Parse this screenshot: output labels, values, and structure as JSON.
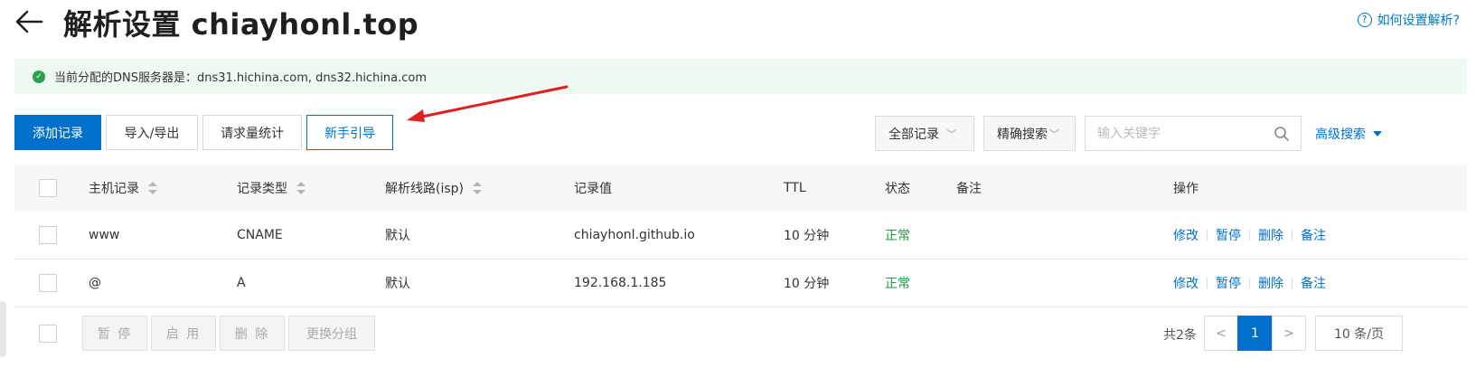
{
  "header": {
    "title": "解析设置 chiayhonl.top",
    "help_link": "如何设置解析?",
    "help_icon": "?"
  },
  "banner": {
    "text": "当前分配的DNS服务器是：dns31.hichina.com, dns32.hichina.com"
  },
  "toolbar": {
    "add_record": "添加记录",
    "import_export": "导入/导出",
    "request_stats": "请求量统计",
    "beginner_guide": "新手引导",
    "record_filter": "全部记录",
    "search_mode": "精确搜索",
    "search_placeholder": "输入关键字",
    "advanced_search": "高级搜索"
  },
  "table": {
    "columns": [
      "主机记录",
      "记录类型",
      "解析线路(isp)",
      "记录值",
      "TTL",
      "状态",
      "备注",
      "操作"
    ],
    "rows": [
      {
        "host": "www",
        "type": "CNAME",
        "line": "默认",
        "value": "chiayhonl.github.io",
        "ttl": "10 分钟",
        "status": "正常",
        "note": ""
      },
      {
        "host": "@",
        "type": "A",
        "line": "默认",
        "value": "192.168.1.185",
        "ttl": "10 分钟",
        "status": "正常",
        "note": ""
      }
    ],
    "actions": [
      "修改",
      "暂停",
      "删除",
      "备注"
    ]
  },
  "bulk_actions": [
    "暂 停",
    "启 用",
    "删 除",
    "更换分组"
  ],
  "pagination": {
    "total": "共2条",
    "prev": "<",
    "current": "1",
    "next": ">",
    "page_size": "10 条/页"
  },
  "colors": {
    "primary": "#0070cc",
    "success": "#1d9a3e",
    "banner_bg": "#eefaf1",
    "annotation_arrow": "#e02020"
  }
}
